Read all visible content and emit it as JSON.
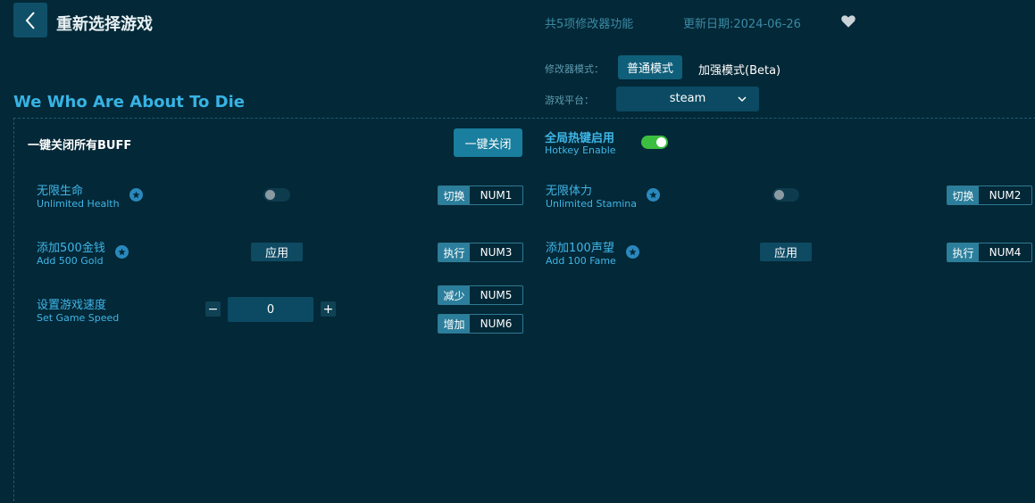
{
  "header": {
    "title": "重新选择游戏",
    "feature_count": "共5项修改器功能",
    "update_date": "更新日期:2024-06-26"
  },
  "mode": {
    "label": "修改器模式：",
    "normal": "普通模式",
    "beta": "加强模式(Beta)"
  },
  "platform": {
    "label": "游戏平台：",
    "value": "steam"
  },
  "game_title": "We Who Are About To Die",
  "close_all": {
    "label": "一键关闭所有BUFF",
    "button": "一键关闭"
  },
  "hotkey_enable": {
    "zh": "全局热键启用",
    "en": "Hotkey Enable",
    "enabled": true
  },
  "cheats": [
    {
      "zh": "无限生命",
      "en": "Unlimited Health",
      "action": "切换",
      "key": "NUM1",
      "enabled": false
    },
    {
      "zh": "无限体力",
      "en": "Unlimited Stamina",
      "action": "切换",
      "key": "NUM2",
      "enabled": false
    },
    {
      "zh": "添加500金钱",
      "en": "Add 500 Gold",
      "button": "应用",
      "action": "执行",
      "key": "NUM3"
    },
    {
      "zh": "添加100声望",
      "en": "Add 100 Fame",
      "button": "应用",
      "action": "执行",
      "key": "NUM4"
    }
  ],
  "speed": {
    "zh": "设置游戏速度",
    "en": "Set Game Speed",
    "value": "0",
    "minus": "−",
    "plus": "+",
    "dec_action": "减少",
    "dec_key": "NUM5",
    "inc_action": "增加",
    "inc_key": "NUM6"
  },
  "colors": {
    "background": "#032837",
    "accent": "#3fb6e8",
    "toggle_on": "#3cbf40"
  }
}
